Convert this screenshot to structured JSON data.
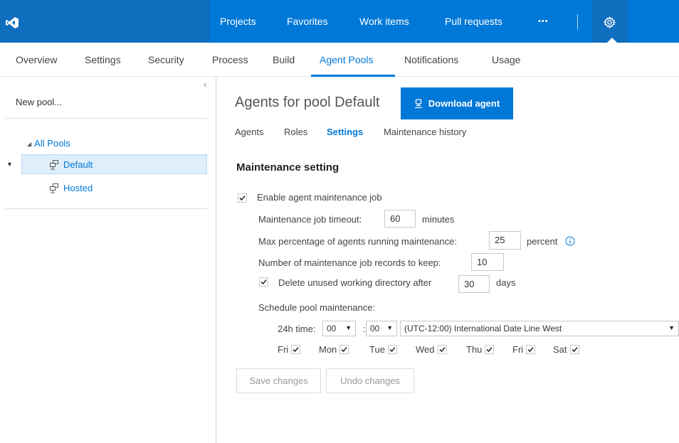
{
  "topnav": {
    "items": [
      "Projects",
      "Favorites",
      "Work items",
      "Pull requests"
    ],
    "more": "•••"
  },
  "subnav": {
    "items": [
      "Overview",
      "Settings",
      "Security",
      "Process",
      "Build",
      "Agent Pools",
      "Notifications",
      "Usage"
    ],
    "active": "Agent Pools"
  },
  "left": {
    "collapse": "‹",
    "new_pool": "New pool...",
    "all_pools": "All Pools",
    "pools": [
      "Default",
      "Hosted"
    ]
  },
  "main": {
    "heading": "Agents for pool Default",
    "download_button": "Download agent",
    "tabs": [
      "Agents",
      "Roles",
      "Settings",
      "Maintenance history"
    ],
    "active_tab": "Settings",
    "section_title": "Maintenance setting",
    "enable_label": "Enable agent maintenance job",
    "enable_checked": true,
    "timeout_label": "Maintenance job timeout:",
    "timeout_value": "60",
    "timeout_unit": "minutes",
    "maxpct_label": "Max percentage of agents running maintenance:",
    "maxpct_value": "25",
    "maxpct_unit": "percent",
    "records_label": "Number of maintenance job records to keep:",
    "records_value": "10",
    "delete_label": "Delete unused working directory after",
    "delete_checked": true,
    "delete_value": "30",
    "delete_unit": "days",
    "schedule_label": "Schedule pool maintenance:",
    "time_label": "24h time:",
    "hour": "00",
    "minute": "00",
    "colon": ":",
    "timezone": "(UTC-12:00) International Date Line West",
    "days": [
      {
        "label": "Fri",
        "checked": true
      },
      {
        "label": "Mon",
        "checked": true
      },
      {
        "label": "Tue",
        "checked": true
      },
      {
        "label": "Wed",
        "checked": true
      },
      {
        "label": "Thu",
        "checked": true
      },
      {
        "label": "Fri",
        "checked": true
      },
      {
        "label": "Sat",
        "checked": true
      }
    ],
    "save_button": "Save changes",
    "undo_button": "Undo changes"
  },
  "colors": {
    "brand": "#0078d7",
    "brand_dark": "#106ebe",
    "selected_row": "#deeefb"
  },
  "icons": [
    "visual-studio-logo-icon",
    "gear-icon",
    "pool-icon",
    "download-agent-icon",
    "info-icon",
    "checkbox-check-icon"
  ]
}
